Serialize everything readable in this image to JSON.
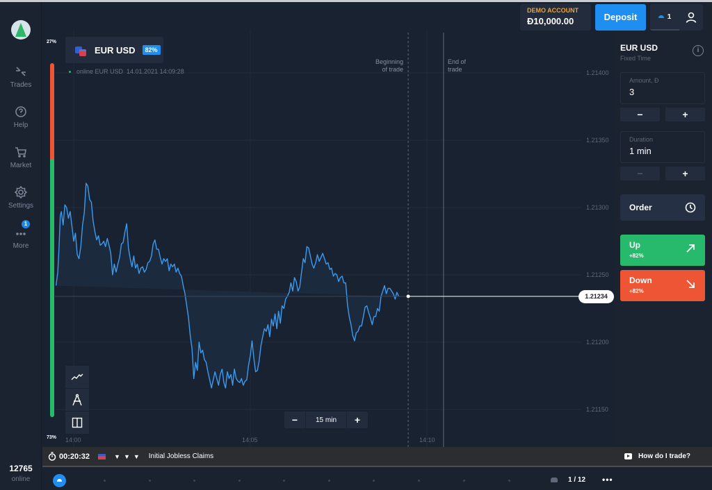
{
  "sidebar": {
    "items": [
      {
        "label": "Trades",
        "icon": "arrows-collapse-icon"
      },
      {
        "label": "Help",
        "icon": "help-icon"
      },
      {
        "label": "Market",
        "icon": "cart-icon"
      },
      {
        "label": "Settings",
        "icon": "gear-icon"
      },
      {
        "label": "More",
        "icon": "more-dots-icon",
        "badge": "1"
      }
    ],
    "online_count": "12765",
    "online_label": "online"
  },
  "header": {
    "account_label": "DEMO ACCOUNT",
    "balance": "Đ10,000.00",
    "deposit_label": "Deposit",
    "open_trades_count": "1"
  },
  "asset": {
    "name": "EUR USD",
    "payout": "82%",
    "status": "online EUR USD  14.01.2021 14:09:28"
  },
  "sentiment": {
    "up_pct_label": "73%",
    "down_pct_label": "27%",
    "up_fraction": 0.73,
    "down_fraction": 0.27
  },
  "chart_data": {
    "type": "line",
    "title": "EUR USD",
    "xlabel": "",
    "ylabel": "",
    "x_unit": "minutes after 14:00",
    "x_ticks": [
      "14:00",
      "14:05",
      "14:10"
    ],
    "x_tick_values": [
      0,
      5,
      10
    ],
    "y_ticks": [
      "1.21400",
      "1.21350",
      "1.21300",
      "1.21250",
      "1.21200",
      "1.21150"
    ],
    "y_tick_values": [
      1.214,
      1.2135,
      1.213,
      1.2125,
      1.212,
      1.2115
    ],
    "ylim": [
      1.21139,
      1.21405
    ],
    "xlim": [
      -0.27,
      10.5
    ],
    "grid": true,
    "current_price": "1.21234",
    "current_price_value": 1.21234,
    "beginning_of_trade_label": "Beginning of trade",
    "end_of_trade_label": "End of trade",
    "beginning_of_trade_x": 9.47,
    "end_of_trade_x": 10.47,
    "series": [
      {
        "name": "EUR USD",
        "x": [
          -0.5,
          -0.45,
          -0.42,
          -0.38,
          -0.35,
          -0.3,
          -0.25,
          -0.2,
          -0.15,
          -0.1,
          -0.05,
          0.0,
          0.05,
          0.1,
          0.15,
          0.2,
          0.25,
          0.3,
          0.35,
          0.4,
          0.45,
          0.5,
          0.55,
          0.6,
          0.65,
          0.7,
          0.75,
          0.8,
          0.85,
          0.9,
          0.95,
          1.0,
          1.05,
          1.1,
          1.15,
          1.2,
          1.25,
          1.3,
          1.35,
          1.4,
          1.45,
          1.5,
          1.55,
          1.6,
          1.65,
          1.7,
          1.75,
          1.8,
          1.85,
          1.9,
          1.95,
          2.0,
          2.05,
          2.1,
          2.15,
          2.2,
          2.25,
          2.3,
          2.35,
          2.4,
          2.45,
          2.5,
          2.55,
          2.6,
          2.65,
          2.7,
          2.75,
          2.8,
          2.85,
          2.9,
          2.95,
          3.0,
          3.05,
          3.1,
          3.15,
          3.2,
          3.25,
          3.3,
          3.35,
          3.4,
          3.45,
          3.5,
          3.55,
          3.6,
          3.65,
          3.7,
          3.75,
          3.8,
          3.85,
          3.9,
          3.95,
          4.0,
          4.05,
          4.1,
          4.15,
          4.2,
          4.25,
          4.3,
          4.35,
          4.4,
          4.45,
          4.5,
          4.55,
          4.6,
          4.65,
          4.7,
          4.75,
          4.8,
          4.85,
          4.9,
          4.95,
          5.0,
          5.05,
          5.1,
          5.15,
          5.2,
          5.25,
          5.3,
          5.35,
          5.4,
          5.45,
          5.5,
          5.55,
          5.6,
          5.65,
          5.7,
          5.75,
          5.8,
          5.85,
          5.9,
          5.95,
          6.0,
          6.05,
          6.1,
          6.15,
          6.2,
          6.25,
          6.3,
          6.35,
          6.4,
          6.45,
          6.5,
          6.55,
          6.6,
          6.65,
          6.7,
          6.75,
          6.8,
          6.85,
          6.9,
          6.95,
          7.0,
          7.05,
          7.1,
          7.15,
          7.2,
          7.25,
          7.3,
          7.35,
          7.4,
          7.45,
          7.5,
          7.55,
          7.6,
          7.65,
          7.7,
          7.75,
          7.8,
          7.85,
          7.9,
          7.95,
          8.0,
          8.05,
          8.1,
          8.15,
          8.2,
          8.25,
          8.3,
          8.35,
          8.4,
          8.45,
          8.5,
          8.55,
          8.6,
          8.65,
          8.7,
          8.75,
          8.8,
          8.85,
          8.9,
          8.95,
          9.0,
          9.05,
          9.1,
          9.15,
          9.2,
          9.25,
          9.3,
          9.35,
          9.4,
          9.47
        ],
        "values": [
          1.21242,
          1.21252,
          1.21268,
          1.21294,
          1.21297,
          1.21287,
          1.21302,
          1.213,
          1.21292,
          1.21297,
          1.21286,
          1.21275,
          1.21281,
          1.21265,
          1.21262,
          1.21271,
          1.21287,
          1.21296,
          1.21318,
          1.21316,
          1.21306,
          1.21304,
          1.2129,
          1.21282,
          1.21276,
          1.21279,
          1.21272,
          1.21273,
          1.21275,
          1.21271,
          1.21277,
          1.21272,
          1.21266,
          1.2125,
          1.21258,
          1.21252,
          1.21258,
          1.21263,
          1.21273,
          1.21274,
          1.21282,
          1.21288,
          1.2127,
          1.21262,
          1.21256,
          1.21264,
          1.21255,
          1.21258,
          1.21251,
          1.21255,
          1.21256,
          1.21252,
          1.21254,
          1.21259,
          1.2126,
          1.21264,
          1.21273,
          1.21276,
          1.21269,
          1.21269,
          1.21263,
          1.21258,
          1.21262,
          1.2126,
          1.21262,
          1.21253,
          1.21258,
          1.21256,
          1.21258,
          1.21252,
          1.21255,
          1.21251,
          1.21249,
          1.21242,
          1.21236,
          1.21227,
          1.21218,
          1.21205,
          1.21195,
          1.21173,
          1.21185,
          1.21179,
          1.212,
          1.21192,
          1.21194,
          1.21187,
          1.21185,
          1.21178,
          1.21172,
          1.21166,
          1.21172,
          1.21178,
          1.21173,
          1.21168,
          1.21176,
          1.2118,
          1.2117,
          1.21166,
          1.21178,
          1.21173,
          1.21176,
          1.21168,
          1.2118,
          1.21173,
          1.21171,
          1.2117,
          1.21173,
          1.21168,
          1.21171,
          1.21172,
          1.21183,
          1.2119,
          1.21201,
          1.21188,
          1.21178,
          1.21179,
          1.21186,
          1.21197,
          1.21204,
          1.2121,
          1.21208,
          1.21213,
          1.21204,
          1.21217,
          1.21212,
          1.21221,
          1.2121,
          1.21223,
          1.21214,
          1.21227,
          1.21225,
          1.21232,
          1.21234,
          1.21237,
          1.21244,
          1.21238,
          1.21248,
          1.21245,
          1.21238,
          1.21241,
          1.21252,
          1.21262,
          1.21259,
          1.21271,
          1.2127,
          1.21264,
          1.21258,
          1.21255,
          1.21259,
          1.21265,
          1.2126,
          1.21263,
          1.21266,
          1.21262,
          1.21258,
          1.21259,
          1.21254,
          1.21255,
          1.21249,
          1.21251,
          1.2125,
          1.21245,
          1.21248,
          1.21249,
          1.21244,
          1.21244,
          1.21228,
          1.21219,
          1.21213,
          1.21205,
          1.21201,
          1.21207,
          1.21208,
          1.21212,
          1.21212,
          1.21219,
          1.21226,
          1.21227,
          1.21222,
          1.21218,
          1.21213,
          1.21219,
          1.21219,
          1.21225,
          1.21223,
          1.21234,
          1.21238,
          1.21242,
          1.21236,
          1.2124,
          1.2124,
          1.21238,
          1.21236,
          1.21232,
          1.21237,
          1.21234
        ]
      }
    ]
  },
  "chart_tools": [
    {
      "name": "chart-type-icon"
    },
    {
      "name": "drawing-tools-icon"
    },
    {
      "name": "split-view-icon"
    }
  ],
  "timeframe": {
    "minus": "−",
    "value": "15 min",
    "plus": "+"
  },
  "trade_panel": {
    "asset_name": "EUR USD",
    "mode": "Fixed Time",
    "amount_label": "Amount, Đ",
    "amount_value": "3",
    "duration_label": "Duration",
    "duration_value": "1 min",
    "minus": "−",
    "plus": "+",
    "order_label": "Order",
    "up_label": "Up",
    "up_payout": "+82%",
    "down_label": "Down",
    "down_payout": "+82%",
    "colors": {
      "up": "#27b96c",
      "down": "#ee5535",
      "accent": "#1e8ff0"
    }
  },
  "news": {
    "timer": "00:20:32",
    "title": "Initial Jobless Claims",
    "importance": 3,
    "help_label": "How do I trade?"
  },
  "bottom": {
    "page": "1 / 12",
    "more": "•••"
  }
}
